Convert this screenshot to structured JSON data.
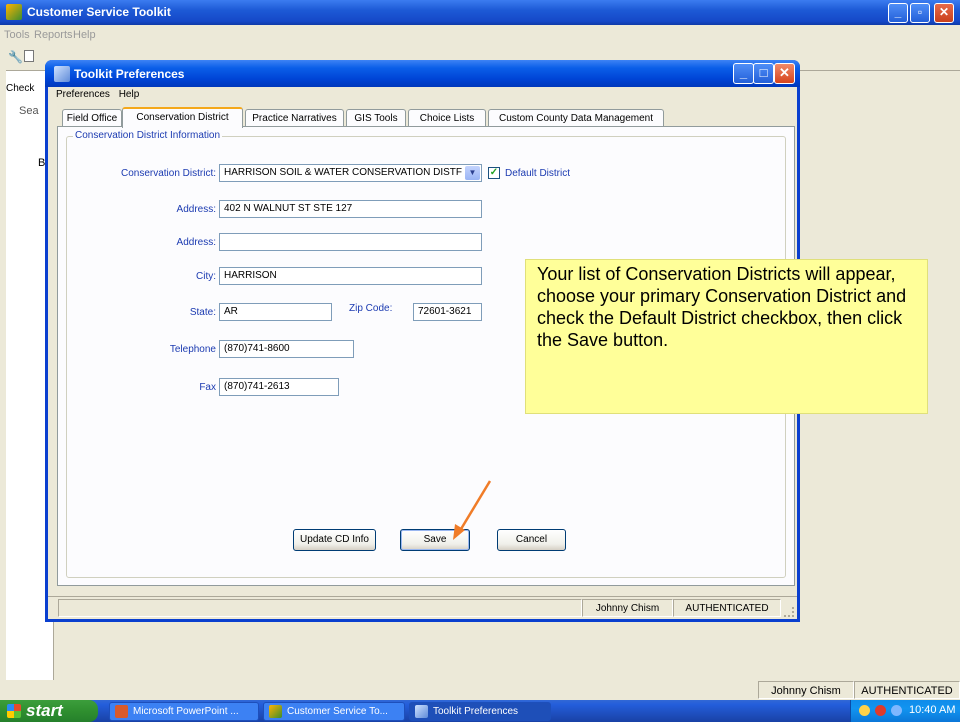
{
  "app": {
    "title": "Customer Service Toolkit",
    "menu": [
      "Tools",
      "Reports",
      "Help"
    ],
    "side_labels": [
      "Check",
      "Sea",
      "Bu"
    ],
    "status": {
      "user": "Johnny Chism",
      "auth": "AUTHENTICATED"
    }
  },
  "dialog": {
    "title": "Toolkit Preferences",
    "menu": [
      "Preferences",
      "Help"
    ],
    "tabs": [
      "Field Office",
      "Conservation District",
      "Practice Narratives",
      "GIS Tools",
      "Choice Lists",
      "Custom County Data Management"
    ],
    "active_tab": "Conservation District",
    "group_title": "Conservation District Information",
    "fields": {
      "district_label": "Conservation District:",
      "district_value": "HARRISON SOIL & WATER CONSERVATION DISTF",
      "default_label": "Default District",
      "default_checked": true,
      "address1_label": "Address:",
      "address1_value": "402 N WALNUT ST STE 127",
      "address2_label": "Address:",
      "address2_value": "",
      "city_label": "City:",
      "city_value": "HARRISON",
      "state_label": "State:",
      "state_value": "AR",
      "zip_label": "Zip Code:",
      "zip_value": "72601-3621",
      "phone_label": "Telephone",
      "phone_value": "(870)741-8600",
      "fax_label": "Fax",
      "fax_value": "(870)741-2613"
    },
    "buttons": {
      "update": "Update CD Info",
      "save": "Save",
      "cancel": "Cancel"
    },
    "status": {
      "user": "Johnny Chism",
      "auth": "AUTHENTICATED"
    }
  },
  "callout": {
    "text": "Your list of Conservation Districts will appear, choose your primary Conservation District and check the Default District checkbox, then click the Save button."
  },
  "taskbar": {
    "start": "start",
    "tasks": [
      "Microsoft PowerPoint ...",
      "Customer Service To...",
      "Toolkit Preferences"
    ],
    "active_task": "Toolkit Preferences",
    "clock": "10:40 AM"
  },
  "colors": {
    "label_blue": "#1c3bb1",
    "callout_yellow": "#ffff99",
    "arrow_orange": "#f07c28",
    "title_blue": "#0a5ee8"
  }
}
